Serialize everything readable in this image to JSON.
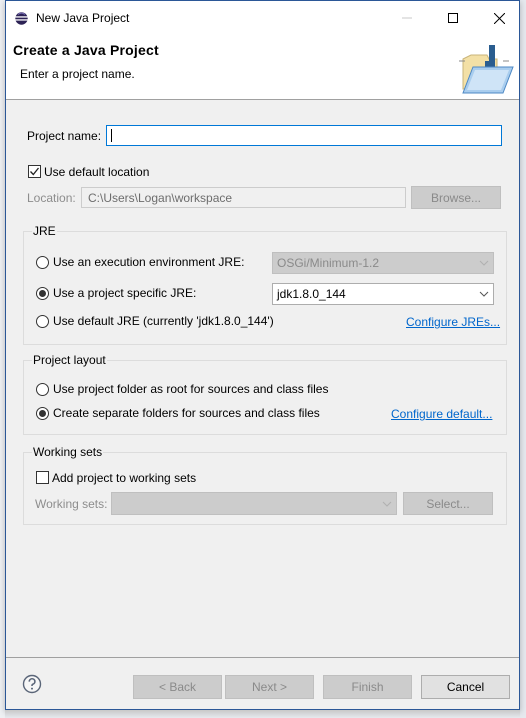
{
  "window": {
    "title": "New Java Project",
    "icon": "eclipse-icon",
    "controls": [
      "minimize-icon",
      "maximize-icon",
      "close-icon"
    ]
  },
  "header": {
    "title": "Create a Java Project",
    "description": "Enter a project name.",
    "image": "java-project-folder-icon"
  },
  "project_name": {
    "label": "Project name:",
    "value": "",
    "placeholder": ""
  },
  "location": {
    "use_default_label": "Use default location",
    "use_default_checked": true,
    "label": "Location:",
    "value": "C:\\Users\\Logan\\workspace",
    "browse_label": "Browse..."
  },
  "jre": {
    "group_title": "JRE",
    "options": [
      {
        "label": "Use an execution environment JRE:",
        "selected": false,
        "combo_value": "OSGi/Minimum-1.2",
        "combo_enabled": false
      },
      {
        "label": "Use a project specific JRE:",
        "selected": true,
        "combo_value": "jdk1.8.0_144",
        "combo_enabled": true
      },
      {
        "label": "Use default JRE (currently 'jdk1.8.0_144')",
        "selected": false
      }
    ],
    "configure_link": "Configure JREs..."
  },
  "project_layout": {
    "group_title": "Project layout",
    "options": [
      {
        "label": "Use project folder as root for sources and class files",
        "selected": false
      },
      {
        "label": "Create separate folders for sources and class files",
        "selected": true
      }
    ],
    "configure_link": "Configure default..."
  },
  "working_sets": {
    "group_title": "Working sets",
    "add_label": "Add project to working sets",
    "add_checked": false,
    "label": "Working sets:",
    "value": "",
    "select_label": "Select..."
  },
  "footer": {
    "help_icon": "help-icon",
    "back_label": "< Back",
    "next_label": "Next >",
    "finish_label": "Finish",
    "cancel_label": "Cancel"
  },
  "colors": {
    "link": "#0066cc",
    "focus_border": "#0078d7",
    "window_border": "#2b5797"
  }
}
